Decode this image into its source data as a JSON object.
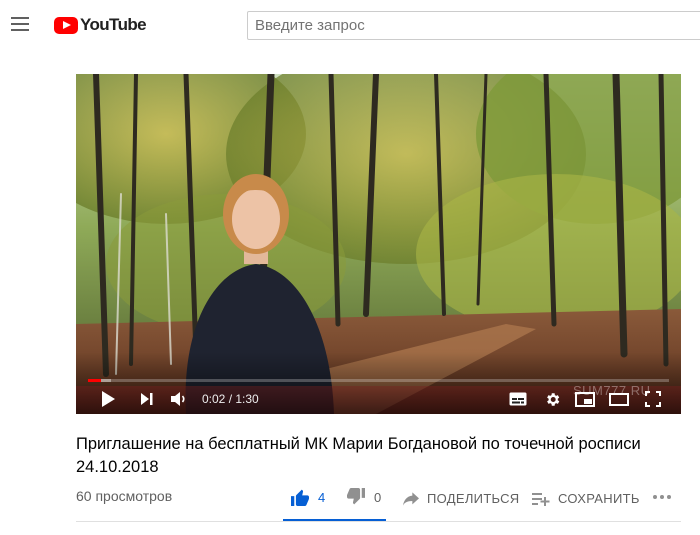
{
  "header": {
    "logo_text": "YouTube",
    "search_placeholder": "Введите запрос"
  },
  "player": {
    "current_time": "0:02",
    "duration": "1:30",
    "time_display": "0:02 / 1:30",
    "progress_played_fraction": 0.022,
    "progress_loaded_fraction": 0.04,
    "watermark": "SUM777.RU",
    "progress_color": "#ff0000"
  },
  "video": {
    "title": "Приглашение на бесплатный МК Марии Богдановой по точечной росписи 24.10.2018",
    "views": "60 просмотров"
  },
  "actions": {
    "like_count": "4",
    "dislike_count": "0",
    "share_label": "Поделиться",
    "save_label": "Сохранить",
    "like_color": "#065fd4"
  }
}
